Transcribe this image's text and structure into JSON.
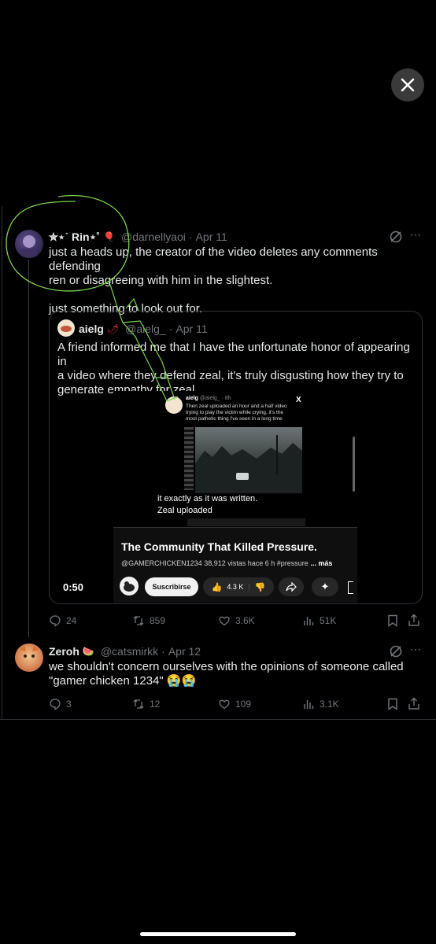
{
  "viewer": {
    "close_label": "✕"
  },
  "tweet1": {
    "display_name": "✮⋆˙ Rin⋆˚",
    "name_emoji": "🎈",
    "handle": "@darnellyaoi",
    "date": "Apr 11",
    "text_line1": "just a heads up, the creator of the video deletes any comments defending",
    "text_line2": "ren or disagreeing with him in the slightest.",
    "text_line3": "just something to look out for.",
    "quote": {
      "display_name": "aielg",
      "emoji": "🌶",
      "handle": "@aielg_",
      "date": "Apr 11",
      "text_line1": "A friend informed me that I have the unfortunate honor of appearing in",
      "text_line2": "a video where they defend zeal, it's truly disgusting how they try to",
      "text_line3": "generate empathy for zeal",
      "embed": {
        "inner_name": "aielg",
        "inner_handle": "@aielg_ · 8h",
        "inner_text1": "Then zeal uploaded an hour and a half video",
        "inner_text2": "trying to play the victim while crying, it's the",
        "inner_text3": "most pathetic thing I've seen in a long time",
        "inner_x": "X",
        "caption1": "it exactly as it was written.",
        "caption2": "Zeal uploaded",
        "video_title": "The Community That Killed Pressure.",
        "channel": "@GAMERCHICKEN1234",
        "views": "38,912 vistas hace 6 h",
        "hashtag": "#pressure",
        "more": "... más",
        "subscribe": "Suscribirse",
        "likes": "4.3 K",
        "time": "0:50"
      }
    },
    "stats": {
      "replies": "24",
      "reposts": "859",
      "likes": "3.6K",
      "views": "51K"
    }
  },
  "tweet2": {
    "display_name": "Zeroh",
    "name_emoji": "🍉",
    "handle": "@catsmirkk",
    "date": "Apr 12",
    "text_line1": "we shouldn't concern ourselves with the opinions of someone called",
    "text_line2": "\"gamer chicken 1234\" 😭😭",
    "stats": {
      "replies": "3",
      "reposts": "12",
      "likes": "109",
      "views": "3.1K"
    }
  },
  "colors": {
    "annotation_green": "#7bd14a",
    "muted": "#71767b",
    "border": "#2f3336"
  },
  "icons": [
    "close-icon",
    "grok-icon",
    "reply-icon",
    "repost-icon",
    "like-icon",
    "views-icon",
    "bookmark-icon",
    "share-icon"
  ]
}
